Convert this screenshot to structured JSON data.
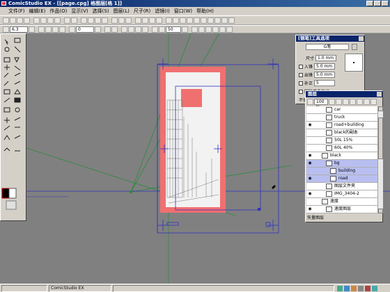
{
  "window": {
    "title": "ComicStudio EX - [[page.cpg] 格图层[格 1]]"
  },
  "menu": [
    "文件(F)",
    "编辑(E)",
    "作品(O)",
    "显示(V)",
    "选择(S)",
    "图层(L)",
    "尺子(R)",
    "滤镜(I)",
    "窗口(W)",
    "帮助(H)"
  ],
  "toolbar2": {
    "zoom_value": "6.3",
    "angle_value": "0",
    "width_value": "50"
  },
  "pen_panel": {
    "title": "[钢笔]工具选项",
    "pen_type": "G笔",
    "size_label": "尺寸",
    "size_value": "1.0 mm",
    "in_label": "入锋",
    "in_value": "5.0 mm",
    "out_label": "出锋",
    "out_value": "5.0 mm",
    "correct_label": "补正",
    "correct_value": "5",
    "extra_label1": "删除重叠的线",
    "extra_label2": "不使"
  },
  "layers_panel": {
    "title": "图层",
    "opacity": "100 %",
    "footer": "矢量图层",
    "layers": [
      {
        "name": "car",
        "visible": false,
        "selected": false,
        "indent": 1
      },
      {
        "name": "truck",
        "visible": false,
        "selected": false,
        "indent": 1
      },
      {
        "name": "road+building",
        "visible": true,
        "selected": false,
        "indent": 1
      },
      {
        "name": "black的副本",
        "visible": false,
        "selected": false,
        "indent": 1
      },
      {
        "name": "50L 15%",
        "visible": false,
        "selected": false,
        "indent": 1
      },
      {
        "name": "60L 40%",
        "visible": false,
        "selected": false,
        "indent": 1
      },
      {
        "name": "black",
        "visible": true,
        "selected": false,
        "indent": 0
      },
      {
        "name": "bg",
        "visible": true,
        "selected": true,
        "indent": 1
      },
      {
        "name": "building",
        "visible": false,
        "selected": true,
        "indent": 2
      },
      {
        "name": "road",
        "visible": true,
        "selected": true,
        "indent": 2
      },
      {
        "name": "图层文件夹",
        "visible": false,
        "selected": false,
        "indent": 1
      },
      {
        "name": "IMG_3404-2",
        "visible": true,
        "selected": false,
        "indent": 1
      },
      {
        "name": "速度",
        "visible": false,
        "selected": false,
        "indent": 0
      },
      {
        "name": "速度图层",
        "visible": true,
        "selected": false,
        "indent": 1
      }
    ]
  },
  "statusbar": {
    "app": "ComicStudio EX"
  },
  "colors": {
    "title_bg": "#0a246a",
    "face": "#d4d0c8",
    "page_red": "#f07070",
    "guide_blue": "#3030c0",
    "persp_green": "#2a8a3a"
  }
}
